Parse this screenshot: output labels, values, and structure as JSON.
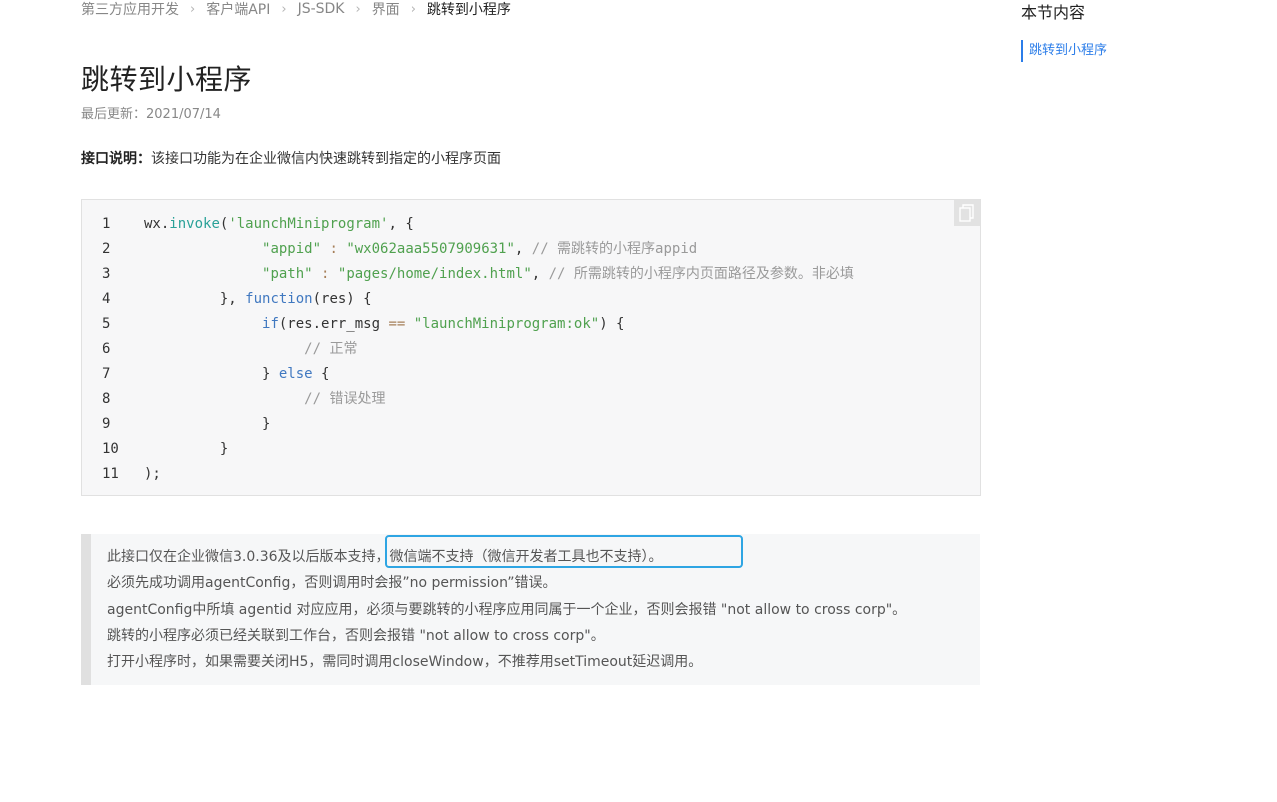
{
  "breadcrumb": [
    "第三方应用开发",
    "客户端API",
    "JS-SDK",
    "界面",
    "跳转到小程序"
  ],
  "page_title": "跳转到小程序",
  "updated": "最后更新：2021/07/14",
  "description": {
    "label": "接口说明：",
    "text": "该接口功能为在企业微信内快速跳转到指定的小程序页面"
  },
  "code": {
    "lines": [
      {
        "num": "1",
        "tokens": [
          {
            "t": "wx",
            "c": "def"
          },
          {
            "t": ".",
            "c": "def"
          },
          {
            "t": "invoke",
            "c": "fn"
          },
          {
            "t": "(",
            "c": "def"
          },
          {
            "t": "'launchMiniprogram'",
            "c": "str"
          },
          {
            "t": ", {",
            "c": "def"
          }
        ]
      },
      {
        "num": "2",
        "tokens": [
          {
            "t": "              ",
            "c": "def"
          },
          {
            "t": "\"appid\"",
            "c": "str"
          },
          {
            "t": " : ",
            "c": "op"
          },
          {
            "t": "\"wx062aaa5507909631\"",
            "c": "str"
          },
          {
            "t": ", ",
            "c": "def"
          },
          {
            "t": "// 需跳转的小程序appid",
            "c": "cm"
          }
        ]
      },
      {
        "num": "3",
        "tokens": [
          {
            "t": "              ",
            "c": "def"
          },
          {
            "t": "\"path\"",
            "c": "str"
          },
          {
            "t": " : ",
            "c": "op"
          },
          {
            "t": "\"pages/home/index.html\"",
            "c": "str"
          },
          {
            "t": ", ",
            "c": "def"
          },
          {
            "t": "// 所需跳转的小程序内页面路径及参数。非必填",
            "c": "cm"
          }
        ]
      },
      {
        "num": "4",
        "tokens": [
          {
            "t": "         }, ",
            "c": "def"
          },
          {
            "t": "function",
            "c": "kw"
          },
          {
            "t": "(res) {",
            "c": "def"
          }
        ]
      },
      {
        "num": "5",
        "tokens": [
          {
            "t": "              ",
            "c": "def"
          },
          {
            "t": "if",
            "c": "kw"
          },
          {
            "t": "(res.err_msg ",
            "c": "def"
          },
          {
            "t": "==",
            "c": "op"
          },
          {
            "t": " ",
            "c": "def"
          },
          {
            "t": "\"launchMiniprogram:ok\"",
            "c": "str"
          },
          {
            "t": ") {",
            "c": "def"
          }
        ]
      },
      {
        "num": "6",
        "tokens": [
          {
            "t": "                   ",
            "c": "def"
          },
          {
            "t": "// 正常",
            "c": "cm"
          }
        ]
      },
      {
        "num": "7",
        "tokens": [
          {
            "t": "              } ",
            "c": "def"
          },
          {
            "t": "else",
            "c": "kw"
          },
          {
            "t": " {",
            "c": "def"
          }
        ]
      },
      {
        "num": "8",
        "tokens": [
          {
            "t": "                   ",
            "c": "def"
          },
          {
            "t": "// 错误处理",
            "c": "cm"
          }
        ]
      },
      {
        "num": "9",
        "tokens": [
          {
            "t": "              }",
            "c": "def"
          }
        ]
      },
      {
        "num": "10",
        "tokens": [
          {
            "t": "         }",
            "c": "def"
          }
        ]
      },
      {
        "num": "11",
        "tokens": [
          {
            "t": ");",
            "c": "def"
          }
        ]
      }
    ]
  },
  "notes": [
    "此接口仅在企业微信3.0.36及以后版本支持，微信端不支持（微信开发者工具也不支持）。",
    "必须先成功调用agentConfig，否则调用时会报”no permission”错误。",
    "agentConfig中所填 agentid 对应应用，必须与要跳转的小程序应用同属于一个企业，否则会报错 \"not allow to cross corp\"。",
    "跳转的小程序必须已经关联到工作台，否则会报错 \"not allow to cross corp\"。",
    "打开小程序时，如果需要关闭H5，需同时调用closeWindow，不推荐用setTimeout延迟调用。"
  ],
  "toc": {
    "title": "本节内容",
    "items": [
      "跳转到小程序"
    ]
  },
  "colors": {
    "accent": "#2b7de9",
    "highlight": "#2ea5e3"
  },
  "icons": {
    "copy": "copy-icon",
    "breadcrumb_separator": "chevron-right-icon"
  }
}
